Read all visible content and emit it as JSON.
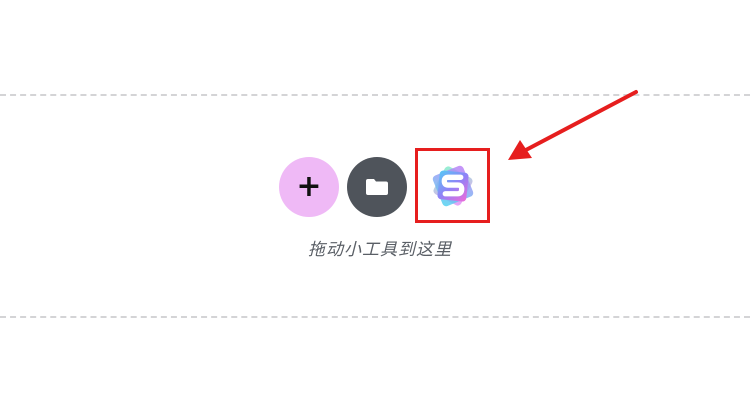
{
  "drop_zone": {
    "hint_text": "拖动小工具到这里"
  },
  "buttons": {
    "add_label": "+",
    "folder_icon": "folder-icon",
    "widget_icon": "s-logo-icon"
  },
  "colors": {
    "add_button_bg": "#efb9f6",
    "folder_button_bg": "#4f545b",
    "annotation_red": "#e61e1e",
    "dashed_border": "#d4d4d6"
  }
}
